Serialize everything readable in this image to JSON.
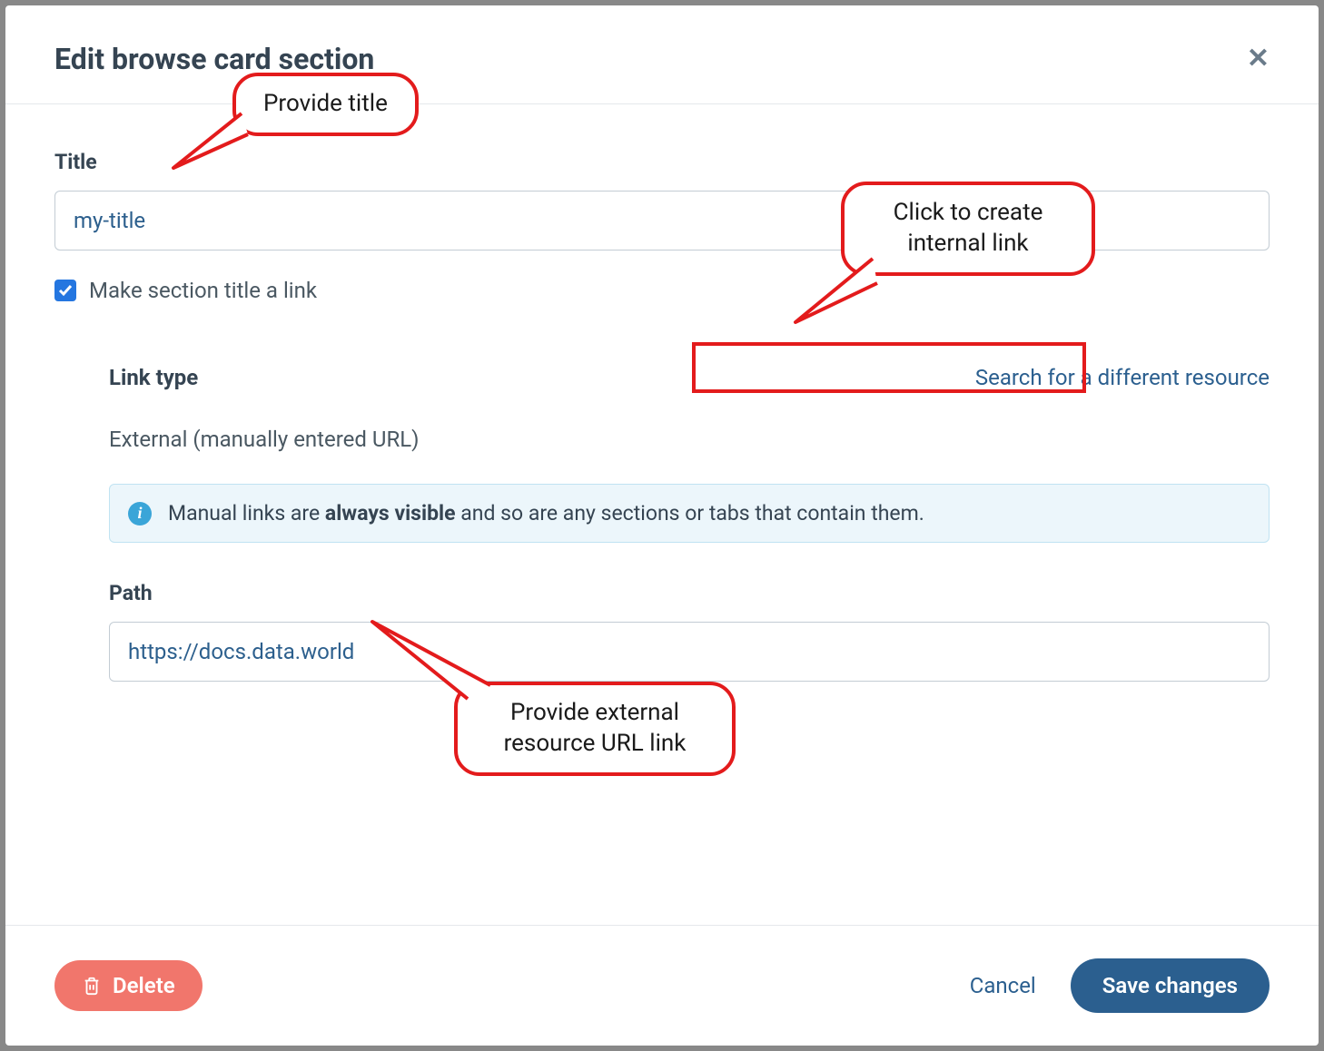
{
  "header": {
    "title": "Edit browse card section"
  },
  "form": {
    "title_label": "Title",
    "title_value": "my-title",
    "checkbox_label": "Make section title a link",
    "checkbox_checked": true,
    "link_type_label": "Link type",
    "search_link_text": "Search for a different resource",
    "link_type_value": "External (manually entered URL)",
    "info_text_before": "Manual links are ",
    "info_text_bold": "always visible",
    "info_text_after": " and so are any sections or tabs that contain them.",
    "path_label": "Path",
    "path_value": "https://docs.data.world"
  },
  "footer": {
    "delete_label": "Delete",
    "cancel_label": "Cancel",
    "save_label": "Save changes"
  },
  "annotations": {
    "callout_title": "Provide title",
    "callout_internal": "Click to create internal link",
    "callout_external": "Provide external resource URL link"
  }
}
